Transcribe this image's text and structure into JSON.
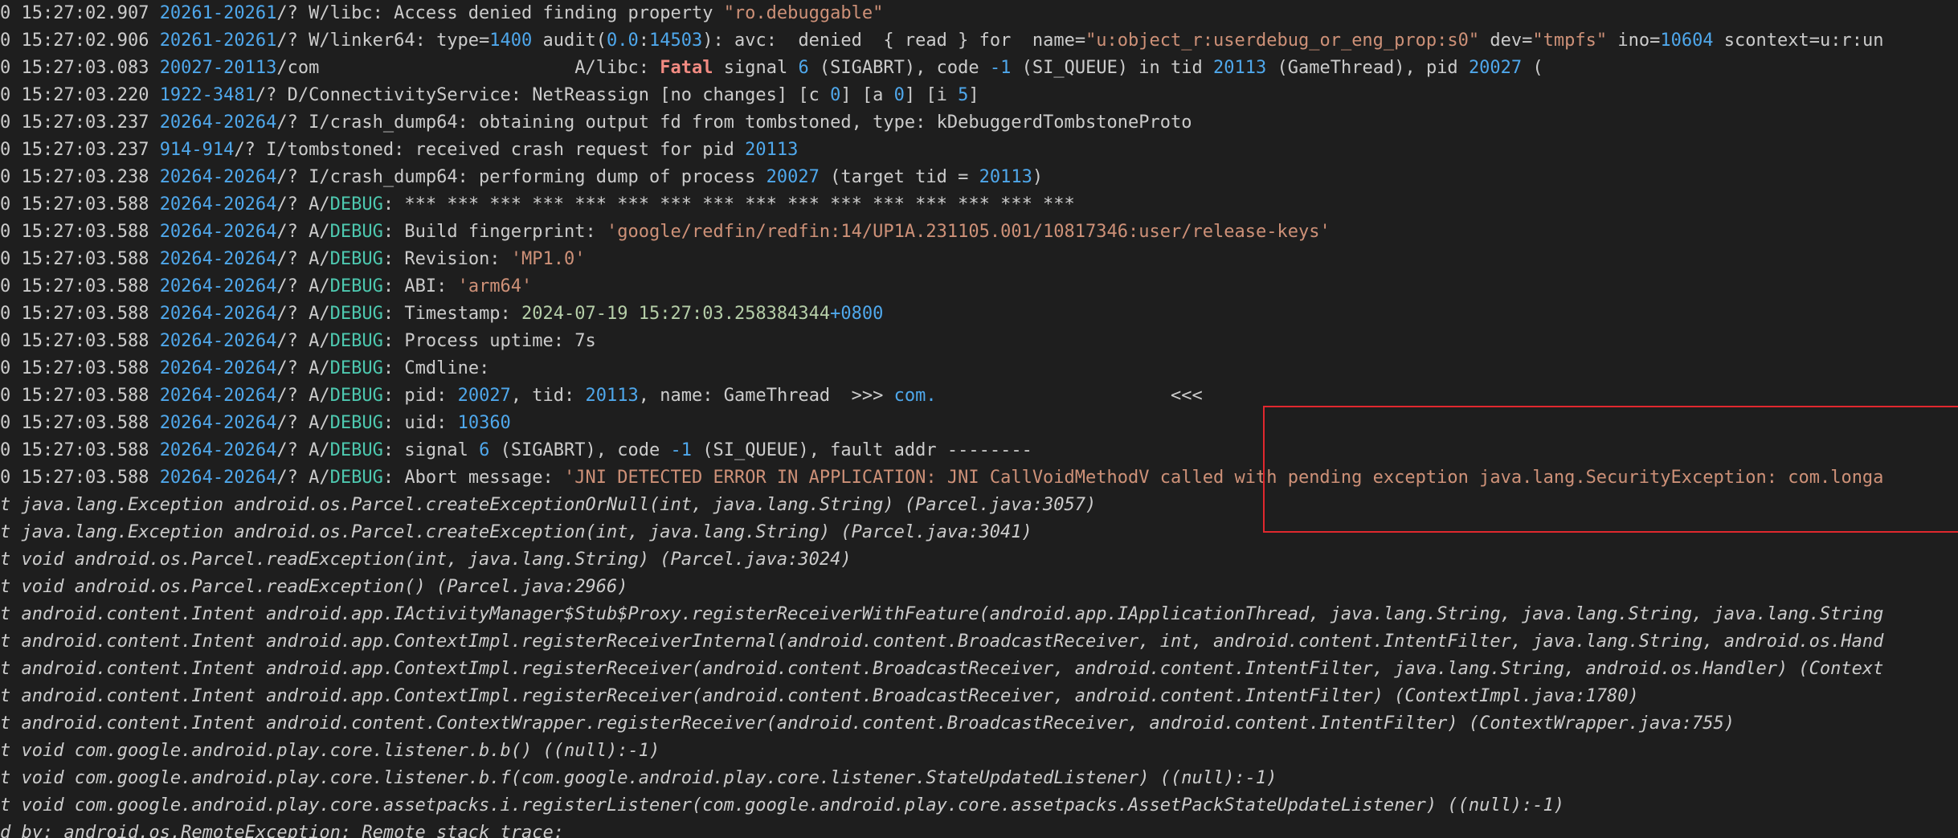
{
  "colors": {
    "background": "#1e1e1e",
    "text": "#cccccc",
    "pid": "#4fa8ec",
    "debug_tag": "#4ec9b0",
    "string": "#ce9178",
    "number": "#4fa8ec",
    "fatal": "#f28b82",
    "date": "#b5cea8",
    "highlight": "#e0282e"
  },
  "lines": [
    {
      "segs": [
        [
          "dim",
          "0 "
        ],
        [
          "time",
          "15:27:02.907 "
        ],
        [
          "pid",
          "20261-20261"
        ],
        [
          "tag",
          "/? W/libc: Access denied finding property "
        ],
        [
          "str",
          "\"ro.debuggable\""
        ]
      ]
    },
    {
      "segs": [
        [
          "dim",
          "0 "
        ],
        [
          "time",
          "15:27:02.906 "
        ],
        [
          "pid",
          "20261-20261"
        ],
        [
          "tag",
          "/? W/linker64: type="
        ],
        [
          "num",
          "1400"
        ],
        [
          "tag",
          " audit("
        ],
        [
          "num",
          "0.0"
        ],
        [
          "tag",
          ":"
        ],
        [
          "num",
          "14503"
        ],
        [
          "tag",
          "): avc:  denied  { read } for  name="
        ],
        [
          "str",
          "\"u:object_r:userdebug_or_eng_prop:s0\""
        ],
        [
          "tag",
          " dev="
        ],
        [
          "str",
          "\"tmpfs\""
        ],
        [
          "tag",
          " ino="
        ],
        [
          "num",
          "10604"
        ],
        [
          "tag",
          " scontext=u:r:un"
        ]
      ]
    },
    {
      "segs": [
        [
          "dim",
          "0 "
        ],
        [
          "time",
          "15:27:03.083 "
        ],
        [
          "pid",
          "20027-20113"
        ],
        [
          "tag",
          "/com"
        ],
        [
          "redact",
          "                        "
        ],
        [
          "tag",
          "A/libc: "
        ],
        [
          "fatal",
          "Fatal"
        ],
        [
          "tag",
          " signal "
        ],
        [
          "num",
          "6"
        ],
        [
          "tag",
          " (SIGABRT), code "
        ],
        [
          "num",
          "-1"
        ],
        [
          "tag",
          " (SI_QUEUE) in tid "
        ],
        [
          "num",
          "20113"
        ],
        [
          "tag",
          " (GameThread), pid "
        ],
        [
          "num",
          "20027"
        ],
        [
          "tag",
          " ("
        ]
      ]
    },
    {
      "segs": [
        [
          "dim",
          "0 "
        ],
        [
          "time",
          "15:27:03.220 "
        ],
        [
          "pid",
          "1922-3481"
        ],
        [
          "tag",
          "/? D/ConnectivityService: NetReassign [no changes] [c "
        ],
        [
          "num",
          "0"
        ],
        [
          "tag",
          "] [a "
        ],
        [
          "num",
          "0"
        ],
        [
          "tag",
          "] [i "
        ],
        [
          "num",
          "5"
        ],
        [
          "tag",
          "]"
        ]
      ]
    },
    {
      "segs": [
        [
          "dim",
          "0 "
        ],
        [
          "time",
          "15:27:03.237 "
        ],
        [
          "pid",
          "20264-20264"
        ],
        [
          "tag",
          "/? I/crash_dump64: obtaining output fd from tombstoned, type: kDebuggerdTombstoneProto"
        ]
      ]
    },
    {
      "segs": [
        [
          "dim",
          "0 "
        ],
        [
          "time",
          "15:27:03.237 "
        ],
        [
          "pid",
          "914-914"
        ],
        [
          "tag",
          "/? I/tombstoned: received crash request for pid "
        ],
        [
          "num",
          "20113"
        ]
      ]
    },
    {
      "segs": [
        [
          "dim",
          "0 "
        ],
        [
          "time",
          "15:27:03.238 "
        ],
        [
          "pid",
          "20264-20264"
        ],
        [
          "tag",
          "/? I/crash_dump64: performing dump of process "
        ],
        [
          "num",
          "20027"
        ],
        [
          "tag",
          " (target tid = "
        ],
        [
          "num",
          "20113"
        ],
        [
          "tag",
          ")"
        ]
      ]
    },
    {
      "segs": [
        [
          "dim",
          "0 "
        ],
        [
          "time",
          "15:27:03.588 "
        ],
        [
          "pid",
          "20264-20264"
        ],
        [
          "tag",
          "/? A/"
        ],
        [
          "debug",
          "DEBUG"
        ],
        [
          "tag",
          ": *** *** *** *** *** *** *** *** *** *** *** *** *** *** *** ***"
        ]
      ]
    },
    {
      "segs": [
        [
          "dim",
          "0 "
        ],
        [
          "time",
          "15:27:03.588 "
        ],
        [
          "pid",
          "20264-20264"
        ],
        [
          "tag",
          "/? A/"
        ],
        [
          "debug",
          "DEBUG"
        ],
        [
          "tag",
          ": Build fingerprint: "
        ],
        [
          "str",
          "'google/redfin/redfin:14/UP1A.231105.001/10817346:user/release-keys'"
        ]
      ]
    },
    {
      "segs": [
        [
          "dim",
          "0 "
        ],
        [
          "time",
          "15:27:03.588 "
        ],
        [
          "pid",
          "20264-20264"
        ],
        [
          "tag",
          "/? A/"
        ],
        [
          "debug",
          "DEBUG"
        ],
        [
          "tag",
          ": Revision: "
        ],
        [
          "str",
          "'MP1.0'"
        ]
      ]
    },
    {
      "segs": [
        [
          "dim",
          "0 "
        ],
        [
          "time",
          "15:27:03.588 "
        ],
        [
          "pid",
          "20264-20264"
        ],
        [
          "tag",
          "/? A/"
        ],
        [
          "debug",
          "DEBUG"
        ],
        [
          "tag",
          ": ABI: "
        ],
        [
          "str",
          "'arm64'"
        ]
      ]
    },
    {
      "segs": [
        [
          "dim",
          "0 "
        ],
        [
          "time",
          "15:27:03.588 "
        ],
        [
          "pid",
          "20264-20264"
        ],
        [
          "tag",
          "/? A/"
        ],
        [
          "debug",
          "DEBUG"
        ],
        [
          "tag",
          ": Timestamp: "
        ],
        [
          "date",
          "2024-07-19 15:27:03.258384344"
        ],
        [
          "num",
          "+0800"
        ]
      ]
    },
    {
      "segs": [
        [
          "dim",
          "0 "
        ],
        [
          "time",
          "15:27:03.588 "
        ],
        [
          "pid",
          "20264-20264"
        ],
        [
          "tag",
          "/? A/"
        ],
        [
          "debug",
          "DEBUG"
        ],
        [
          "tag",
          ": Process uptime: 7s"
        ]
      ]
    },
    {
      "segs": [
        [
          "dim",
          "0 "
        ],
        [
          "time",
          "15:27:03.588 "
        ],
        [
          "pid",
          "20264-20264"
        ],
        [
          "tag",
          "/? A/"
        ],
        [
          "debug",
          "DEBUG"
        ],
        [
          "tag",
          ": Cmdline:"
        ]
      ]
    },
    {
      "segs": [
        [
          "dim",
          "0 "
        ],
        [
          "time",
          "15:27:03.588 "
        ],
        [
          "pid",
          "20264-20264"
        ],
        [
          "tag",
          "/? A/"
        ],
        [
          "debug",
          "DEBUG"
        ],
        [
          "tag",
          ": pid: "
        ],
        [
          "num",
          "20027"
        ],
        [
          "tag",
          ", tid: "
        ],
        [
          "num",
          "20113"
        ],
        [
          "tag",
          ", name: GameThread  >>> "
        ],
        [
          "num",
          "com."
        ],
        [
          "redact",
          "                      "
        ],
        [
          "tag",
          "<<<"
        ]
      ]
    },
    {
      "segs": [
        [
          "dim",
          "0 "
        ],
        [
          "time",
          "15:27:03.588 "
        ],
        [
          "pid",
          "20264-20264"
        ],
        [
          "tag",
          "/? A/"
        ],
        [
          "debug",
          "DEBUG"
        ],
        [
          "tag",
          ": uid: "
        ],
        [
          "num",
          "10360"
        ]
      ]
    },
    {
      "segs": [
        [
          "dim",
          "0 "
        ],
        [
          "time",
          "15:27:03.588 "
        ],
        [
          "pid",
          "20264-20264"
        ],
        [
          "tag",
          "/? A/"
        ],
        [
          "debug",
          "DEBUG"
        ],
        [
          "tag",
          ": signal "
        ],
        [
          "num",
          "6"
        ],
        [
          "tag",
          " (SIGABRT), code "
        ],
        [
          "num",
          "-1"
        ],
        [
          "tag",
          " (SI_QUEUE), fault addr --------"
        ]
      ]
    },
    {
      "segs": [
        [
          "dim",
          "0 "
        ],
        [
          "time",
          "15:27:03.588 "
        ],
        [
          "pid",
          "20264-20264"
        ],
        [
          "tag",
          "/? A/"
        ],
        [
          "debug",
          "DEBUG"
        ],
        [
          "tag",
          ": Abort message: "
        ],
        [
          "str",
          "'JNI DETECTED ERROR IN APPLICATION: JNI CallVoidMethodV called with pending exception java.lang.SecurityException: com.longa"
        ]
      ]
    },
    {
      "segs": [
        [
          "stack",
          "t java.lang.Exception android.os.Parcel.createExceptionOrNull(int, java.lang.String) (Parcel.java:3057)"
        ]
      ]
    },
    {
      "segs": [
        [
          "stack",
          "t java.lang.Exception android.os.Parcel.createException(int, java.lang.String) (Parcel.java:3041)"
        ]
      ]
    },
    {
      "segs": [
        [
          "stack",
          "t void android.os.Parcel.readException(int, java.lang.String) (Parcel.java:3024)"
        ]
      ]
    },
    {
      "segs": [
        [
          "stack",
          "t void android.os.Parcel.readException() (Parcel.java:2966)"
        ]
      ]
    },
    {
      "segs": [
        [
          "stack",
          "t android.content.Intent android.app.IActivityManager$Stub$Proxy.registerReceiverWithFeature(android.app.IApplicationThread, java.lang.String, java.lang.String, java.lang.String"
        ]
      ]
    },
    {
      "segs": [
        [
          "stack",
          "t android.content.Intent android.app.ContextImpl.registerReceiverInternal(android.content.BroadcastReceiver, int, android.content.IntentFilter, java.lang.String, android.os.Hand"
        ]
      ]
    },
    {
      "segs": [
        [
          "stack",
          "t android.content.Intent android.app.ContextImpl.registerReceiver(android.content.BroadcastReceiver, android.content.IntentFilter, java.lang.String, android.os.Handler) (Context"
        ]
      ]
    },
    {
      "segs": [
        [
          "stack",
          "t android.content.Intent android.app.ContextImpl.registerReceiver(android.content.BroadcastReceiver, android.content.IntentFilter) (ContextImpl.java:1780)"
        ]
      ]
    },
    {
      "segs": [
        [
          "stack",
          "t android.content.Intent android.content.ContextWrapper.registerReceiver(android.content.BroadcastReceiver, android.content.IntentFilter) (ContextWrapper.java:755)"
        ]
      ]
    },
    {
      "segs": [
        [
          "stack",
          "t void com.google.android.play.core.listener.b.b() ((null):-1)"
        ]
      ]
    },
    {
      "segs": [
        [
          "stack",
          "t void com.google.android.play.core.listener.b.f(com.google.android.play.core.listener.StateUpdatedListener) ((null):-1)"
        ]
      ]
    },
    {
      "segs": [
        [
          "stack",
          "t void com.google.android.play.core.assetpacks.i.registerListener(com.google.android.play.core.assetpacks.AssetPackStateUpdateListener) ((null):-1)"
        ]
      ]
    },
    {
      "segs": [
        [
          "stack",
          "d by: android.os.RemoteException: Remote stack trace:"
        ]
      ]
    }
  ]
}
